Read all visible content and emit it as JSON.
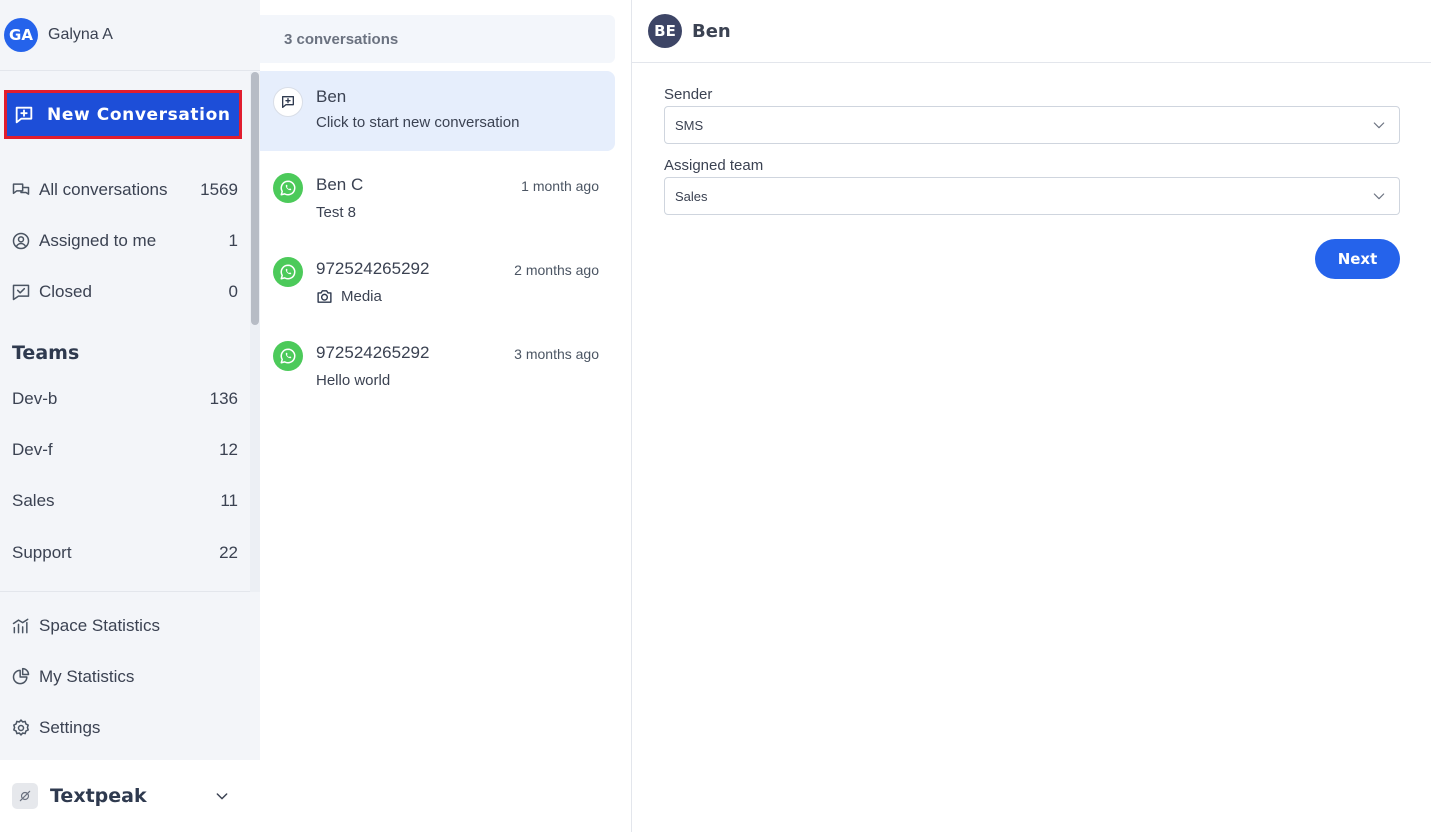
{
  "user": {
    "initials": "GA",
    "name": "Galyna A"
  },
  "new_conversation": {
    "label": "New Conversation"
  },
  "nav": [
    {
      "label": "All conversations",
      "count": "1569",
      "icon": "chat-bubbles-icon"
    },
    {
      "label": "Assigned to me",
      "count": "1",
      "icon": "user-circle-icon"
    },
    {
      "label": "Closed",
      "count": "0",
      "icon": "chat-check-icon"
    }
  ],
  "teams": {
    "heading": "Teams",
    "items": [
      {
        "label": "Dev-b",
        "count": "136"
      },
      {
        "label": "Dev-f",
        "count": "12"
      },
      {
        "label": "Sales",
        "count": "11"
      },
      {
        "label": "Support",
        "count": "22"
      }
    ]
  },
  "bottom_nav": [
    {
      "label": "Space Statistics",
      "icon": "bar-chart-icon"
    },
    {
      "label": "My Statistics",
      "icon": "pie-chart-icon"
    },
    {
      "label": "Settings",
      "icon": "gear-icon"
    }
  ],
  "workspace": {
    "name": "Textpeak",
    "icon": "workspace-logo-icon"
  },
  "conversation_list": {
    "count_label": "3 conversations",
    "new_item": {
      "name": "Ben",
      "subtitle": "Click to start new conversation"
    },
    "items": [
      {
        "name": "Ben C",
        "time": "1 month ago",
        "preview": "Test 8",
        "channel": "whatsapp"
      },
      {
        "name": "972524265292",
        "time": "2 months ago",
        "preview": "Media",
        "channel": "whatsapp",
        "preview_icon": "camera-icon"
      },
      {
        "name": "972524265292",
        "time": "3 months ago",
        "preview": "Hello world",
        "channel": "whatsapp"
      }
    ]
  },
  "detail": {
    "avatar_initials": "BE",
    "name": "Ben",
    "sender": {
      "label": "Sender",
      "value": "SMS"
    },
    "assigned_team": {
      "label": "Assigned team",
      "value": "Sales"
    },
    "next_label": "Next"
  },
  "colors": {
    "primary": "#2563eb",
    "new_conv_bg": "#1d4ed8",
    "highlight_border": "#e11d2e",
    "whatsapp": "#4cca5a",
    "sidebar_bg": "#f3f5f9",
    "active_item_bg": "#e6eefc"
  }
}
